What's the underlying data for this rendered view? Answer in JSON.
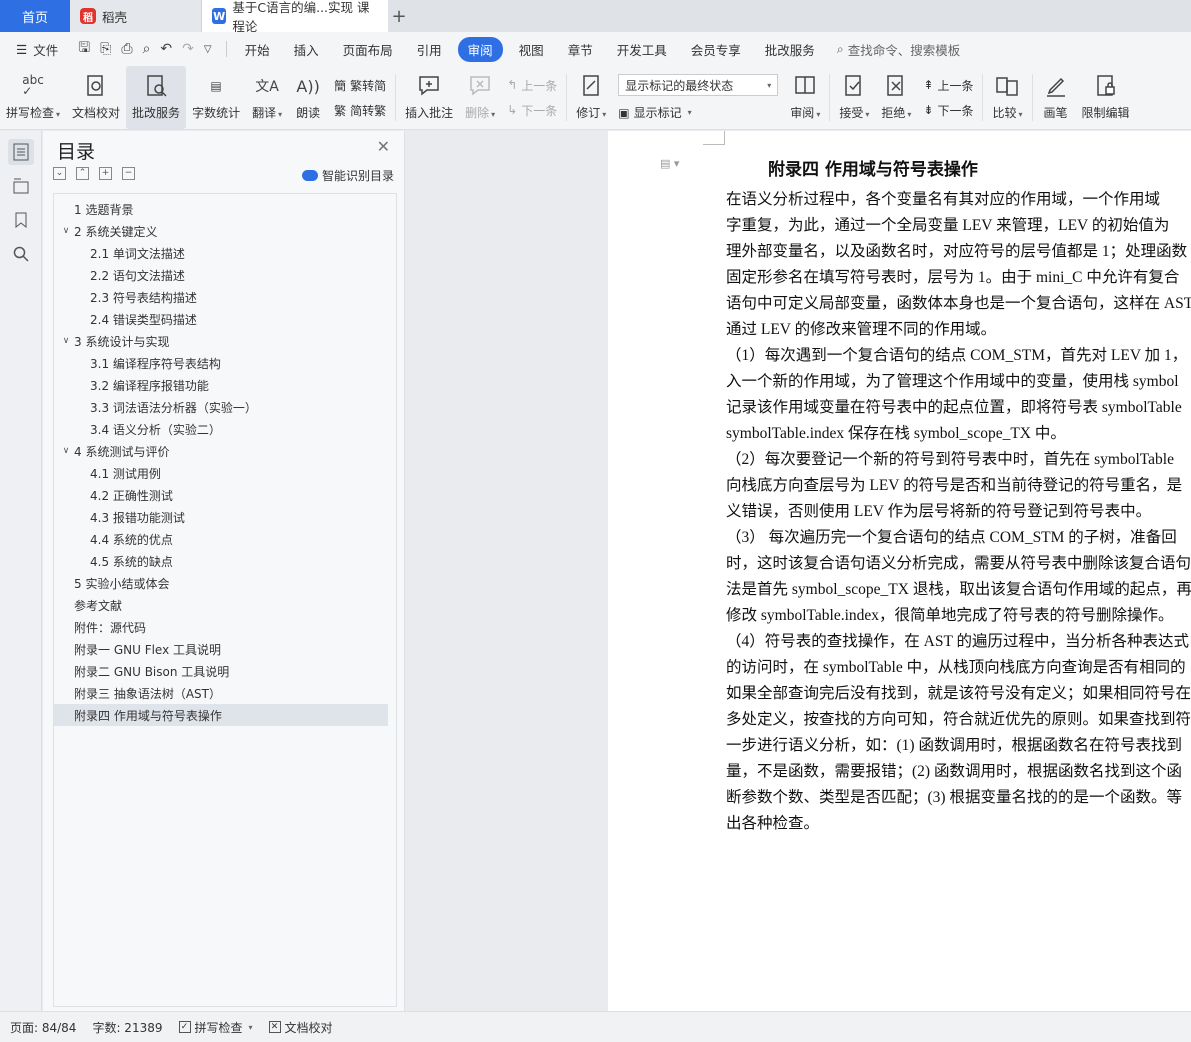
{
  "titlebar": {
    "home_tab": "首页",
    "tabs": [
      {
        "label": "稻壳",
        "icon": "daoke-icon"
      },
      {
        "label": "基于C语言的编...实现 课程论",
        "icon": "wps-writer-icon"
      }
    ],
    "new_tab": "+"
  },
  "menubar": {
    "file_label": "文件",
    "items": [
      "开始",
      "插入",
      "页面布局",
      "引用",
      "审阅",
      "视图",
      "章节",
      "开发工具",
      "会员专享",
      "批改服务"
    ],
    "active": "审阅",
    "search_placeholder": "查找命令、搜索模板"
  },
  "ribbon": {
    "spellcheck": "拼写检查",
    "doc_proof": "文档校对",
    "correction": "批改服务",
    "word_count": "字数统计",
    "translate": "翻译",
    "read_aloud": "朗读",
    "trad_to_simp": "繁转简",
    "simp_to_trad": "简转繁",
    "insert_comment": "插入批注",
    "delete": "删除",
    "prev": "上一条",
    "next": "下一条",
    "revise": "修订",
    "markup_state": "显示标记的最终状态",
    "show_markup": "显示标记",
    "review": "审阅",
    "accept": "接受",
    "reject": "拒绝",
    "prev2": "上一条",
    "next2": "下一条",
    "compare": "比较",
    "pen": "画笔",
    "restrict_edit": "限制编辑"
  },
  "toc": {
    "title": "目录",
    "smart_label": "智能识别目录",
    "items": [
      {
        "label": "1 选题背景",
        "level": 1,
        "arrow": false
      },
      {
        "label": "2 系统关键定义",
        "level": 1,
        "arrow": true
      },
      {
        "label": "2.1 单词文法描述",
        "level": 2
      },
      {
        "label": "2.2 语句文法描述",
        "level": 2
      },
      {
        "label": "2.3  符号表结构描述",
        "level": 2
      },
      {
        "label": "2.4  错误类型码描述",
        "level": 2
      },
      {
        "label": "3 系统设计与实现",
        "level": 1,
        "arrow": true
      },
      {
        "label": "3.1 编译程序符号表结构",
        "level": 2
      },
      {
        "label": "3.2 编译程序报错功能",
        "level": 2
      },
      {
        "label": "3.3 词法语法分析器（实验一）",
        "level": 2
      },
      {
        "label": "3.4 语义分析（实验二）",
        "level": 2
      },
      {
        "label": "4 系统测试与评价",
        "level": 1,
        "arrow": true
      },
      {
        "label": "4.1  测试用例",
        "level": 2
      },
      {
        "label": "4.2  正确性测试",
        "level": 2
      },
      {
        "label": "4.3  报错功能测试",
        "level": 2
      },
      {
        "label": "4.4  系统的优点",
        "level": 2
      },
      {
        "label": "4.5  系统的缺点",
        "level": 2
      },
      {
        "label": "5 实验小结或体会",
        "level": 1,
        "arrow": false
      },
      {
        "label": "参考文献",
        "level": 1,
        "arrow": false
      },
      {
        "label": "附件：源代码",
        "level": 1,
        "arrow": false
      },
      {
        "label": "附录一  GNU Flex  工具说明",
        "level": 1,
        "arrow": false
      },
      {
        "label": "附录二  GNU Bison  工具说明",
        "level": 1,
        "arrow": false
      },
      {
        "label": "附录三  抽象语法树（AST）",
        "level": 1,
        "arrow": false
      },
      {
        "label": "附录四  作用域与符号表操作",
        "level": 1,
        "arrow": false,
        "selected": true
      }
    ]
  },
  "document": {
    "heading": "附录四  作用域与符号表操作",
    "lines": [
      "    在语义分析过程中，各个变量名有其对应的作用域，一个作用域",
      "字重复，为此，通过一个全局变量 LEV 来管理，LEV 的初始值为",
      "理外部变量名，以及函数名时，对应符号的层号值都是 1；处理函数",
      "固定形参名在填写符号表时，层号为 1。由于 mini_C 中允许有复合",
      "语句中可定义局部变量，函数体本身也是一个复合语句，这样在 AST",
      "通过 LEV 的修改来管理不同的作用域。",
      "（1）每次遇到一个复合语句的结点 COM_STM，首先对 LEV 加 1，",
      "入一个新的作用域，为了管理这个作用域中的变量，使用栈 symbol",
      "记录该作用域变量在符号表中的起点位置，即将符号表 symbolTable",
      "symbolTable.index 保存在栈 symbol_scope_TX 中。",
      "（2）每次要登记一个新的符号到符号表中时，首先在 symbolTable",
      "向栈底方向查层号为 LEV 的符号是否和当前待登记的符号重名，是",
      "义错误，否则使用 LEV 作为层号将新的符号登记到符号表中。",
      "（3）  每次遍历完一个复合语句的结点 COM_STM 的子树，准备回",
      "时，这时该复合语句语义分析完成，需要从符号表中删除该复合语句",
      "法是首先 symbol_scope_TX 退栈，取出该复合语句作用域的起点，再",
      "修改 symbolTable.index，很简单地完成了符号表的符号删除操作。",
      "（4）符号表的查找操作，在 AST 的遍历过程中，当分析各种表达式",
      "的访问时，在 symbolTable 中，从栈顶向栈底方向查询是否有相同的",
      "如果全部查询完后没有找到，就是该符号没有定义；如果相同符号在",
      "多处定义，按查找的方向可知，符合就近优先的原则。如果查找到符",
      "一步进行语义分析，如：(1) 函数调用时，根据函数名在符号表找到",
      "量，不是函数，需要报错；(2) 函数调用时，根据函数名找到这个函",
      "断参数个数、类型是否匹配；(3) 根据变量名找的的是一个函数。等",
      "出各种检查。"
    ]
  },
  "statusbar": {
    "page": "页面: 84/84",
    "word_count": "字数: 21389",
    "spellcheck": "拼写检查",
    "doc_proof": "文档校对"
  }
}
